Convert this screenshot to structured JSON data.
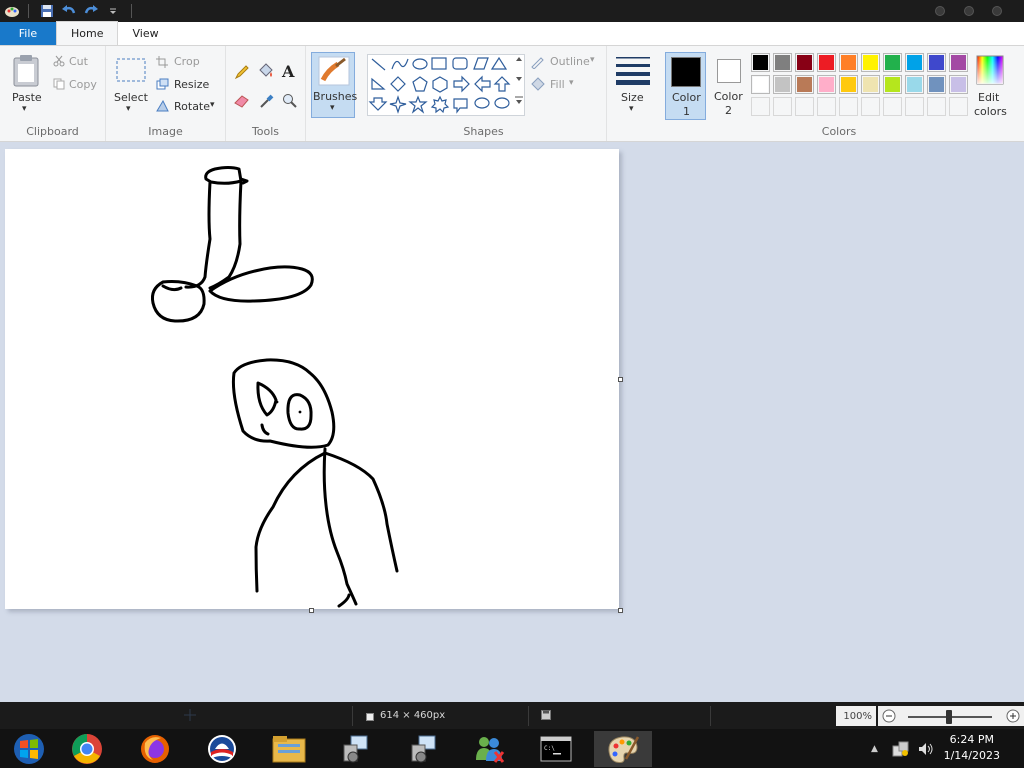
{
  "quick_access": {
    "icons": [
      "paint-app-icon",
      "save-icon",
      "undo-icon",
      "redo-icon",
      "customize-dropdown-icon"
    ]
  },
  "tabs": {
    "file": "File",
    "home": "Home",
    "view": "View"
  },
  "ribbon": {
    "clipboard": {
      "label": "Clipboard",
      "paste": "Paste",
      "cut": "Cut",
      "copy": "Copy"
    },
    "image": {
      "label": "Image",
      "select": "Select",
      "crop": "Crop",
      "resize": "Resize",
      "rotate": "Rotate"
    },
    "tools": {
      "label": "Tools",
      "items": [
        "pencil",
        "fill",
        "text",
        "eraser",
        "color-picker",
        "magnifier"
      ]
    },
    "brushes": {
      "label": "Brushes"
    },
    "shapes": {
      "label": "Shapes",
      "outline": "Outline",
      "fill": "Fill"
    },
    "size": {
      "label": "Size"
    },
    "colors": {
      "label": "Colors",
      "color1": "Color",
      "color1_num": "1",
      "color2": "Color",
      "color2_num": "2",
      "edit": "Edit",
      "edit2": "colors",
      "color1_value": "#000000",
      "color2_value": "#ffffff",
      "palette_row1": [
        "#000000",
        "#7f7f7f",
        "#880015",
        "#ed1c24",
        "#ff7f27",
        "#fff200",
        "#22b14c",
        "#00a2e8",
        "#3f48cc",
        "#a349a4"
      ],
      "palette_row2": [
        "#ffffff",
        "#c3c3c3",
        "#b97a57",
        "#ffaec9",
        "#ffc90e",
        "#efe4b0",
        "#b5e61d",
        "#99d9ea",
        "#7092be",
        "#c8bfe7"
      ]
    }
  },
  "canvas": {
    "background": "#ffffff",
    "stroke_color": "#000000"
  },
  "statusbar": {
    "dimensions": "614 × 460px",
    "zoom": "100%"
  },
  "taskbar": {
    "apps": [
      "windows-start-icon",
      "chrome-icon",
      "firefox-icon",
      "obama-logo-icon",
      "file-explorer-icon",
      "network-setup-icon",
      "network-setup-icon-2",
      "messenger-icon",
      "command-prompt-icon",
      "paint-icon"
    ],
    "time": "6:24 PM",
    "date": "1/14/2023"
  }
}
